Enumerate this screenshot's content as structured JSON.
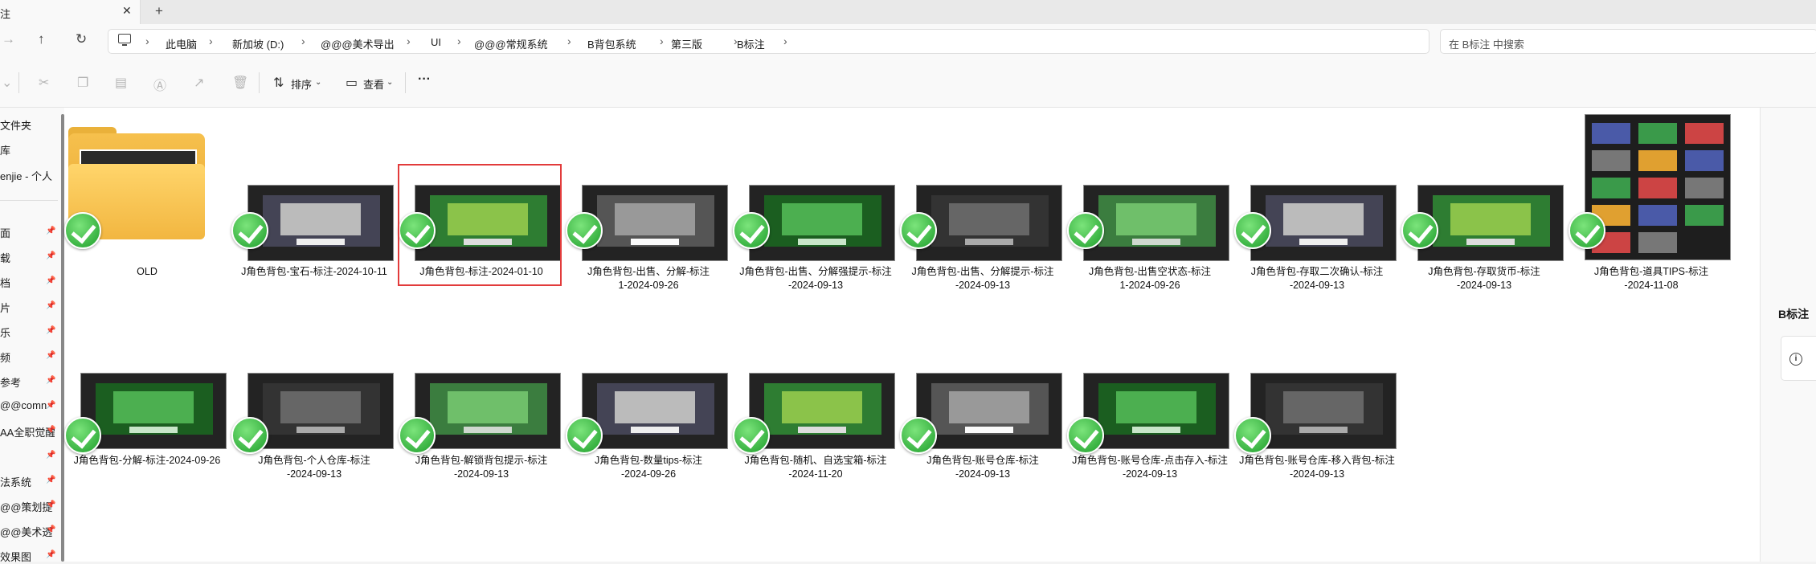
{
  "tab": {
    "title": "注",
    "close": "✕",
    "new": "+"
  },
  "nav": {
    "back": "→",
    "up": "↑",
    "refresh": "↻"
  },
  "breadcrumb": [
    {
      "label": "此电脑"
    },
    {
      "label": "新加坡 (D:)"
    },
    {
      "label": "@@@美术导出"
    },
    {
      "label": "UI"
    },
    {
      "label": "@@@常规系统"
    },
    {
      "label": "B背包系统"
    },
    {
      "label": "第三版"
    },
    {
      "label": "B标注"
    }
  ],
  "search": {
    "placeholder": "在 B标注 中搜索"
  },
  "toolbar": {
    "sort_label": "排序",
    "view_label": "查看",
    "more_label": "···"
  },
  "sidebar": {
    "items": [
      {
        "label": "文件夹",
        "pinned": false
      },
      {
        "label": "库",
        "pinned": false
      },
      {
        "label": "enjie - 个人",
        "pinned": false
      },
      {
        "label": "面",
        "pinned": true
      },
      {
        "label": "载",
        "pinned": true
      },
      {
        "label": "档",
        "pinned": true
      },
      {
        "label": "片",
        "pinned": true
      },
      {
        "label": "乐",
        "pinned": true
      },
      {
        "label": "频",
        "pinned": true
      },
      {
        "label": "参考",
        "pinned": true
      },
      {
        "label": "@@comn",
        "pinned": true
      },
      {
        "label": "AA全职觉醒",
        "pinned": true
      },
      {
        "label": "",
        "pinned": true
      },
      {
        "label": "法系统",
        "pinned": true
      },
      {
        "label": "@@策划提",
        "pinned": true
      },
      {
        "label": "@@美术透",
        "pinned": true
      },
      {
        "label": "效果图",
        "pinned": true
      }
    ]
  },
  "files": [
    {
      "name": "OLD",
      "type": "folder",
      "selected": false
    },
    {
      "name": "J角色背包-宝石-标注-2024-10-11",
      "type": "image",
      "selected": false
    },
    {
      "name": "J角色背包-标注-2024-01-10",
      "type": "image",
      "selected": true
    },
    {
      "name": "J角色背包-出售、分解-标注\n1-2024-09-26",
      "type": "image",
      "selected": false
    },
    {
      "name": "J角色背包-出售、分解强提示-标注\n-2024-09-13",
      "type": "image",
      "selected": false
    },
    {
      "name": "J角色背包-出售、分解提示-标注\n-2024-09-13",
      "type": "image",
      "selected": false
    },
    {
      "name": "J角色背包-出售空状态-标注\n1-2024-09-26",
      "type": "image",
      "selected": false
    },
    {
      "name": "J角色背包-存取二次确认-标注\n-2024-09-13",
      "type": "image",
      "selected": false
    },
    {
      "name": "J角色背包-存取货币-标注\n-2024-09-13",
      "type": "image",
      "selected": false
    },
    {
      "name": "J角色背包-道具TIPS-标注\n-2024-11-08",
      "type": "image",
      "selected": false
    },
    {
      "name": "J角色背包-分解-标注-2024-09-26",
      "type": "image",
      "selected": false
    },
    {
      "name": "J角色背包-个人仓库-标注\n-2024-09-13",
      "type": "image",
      "selected": false
    },
    {
      "name": "J角色背包-解锁背包提示-标注\n-2024-09-13",
      "type": "image",
      "selected": false
    },
    {
      "name": "J角色背包-数量tips-标注\n-2024-09-26",
      "type": "image",
      "selected": false
    },
    {
      "name": "J角色背包-随机、自选宝箱-标注\n-2024-11-20",
      "type": "image",
      "selected": false
    },
    {
      "name": "J角色背包-账号仓库-标注\n-2024-09-13",
      "type": "image",
      "selected": false
    },
    {
      "name": "J角色背包-账号仓库-点击存入-标注\n-2024-09-13",
      "type": "image",
      "selected": false
    },
    {
      "name": "J角色背包-账号仓库-移入背包-标注\n-2024-09-13",
      "type": "image",
      "selected": false
    }
  ],
  "details": {
    "title": "B标注",
    "info_icon": "i"
  },
  "colors": {
    "check": "#1e9e2b",
    "selection": "#e23b3b",
    "folder": "#f2b640"
  }
}
